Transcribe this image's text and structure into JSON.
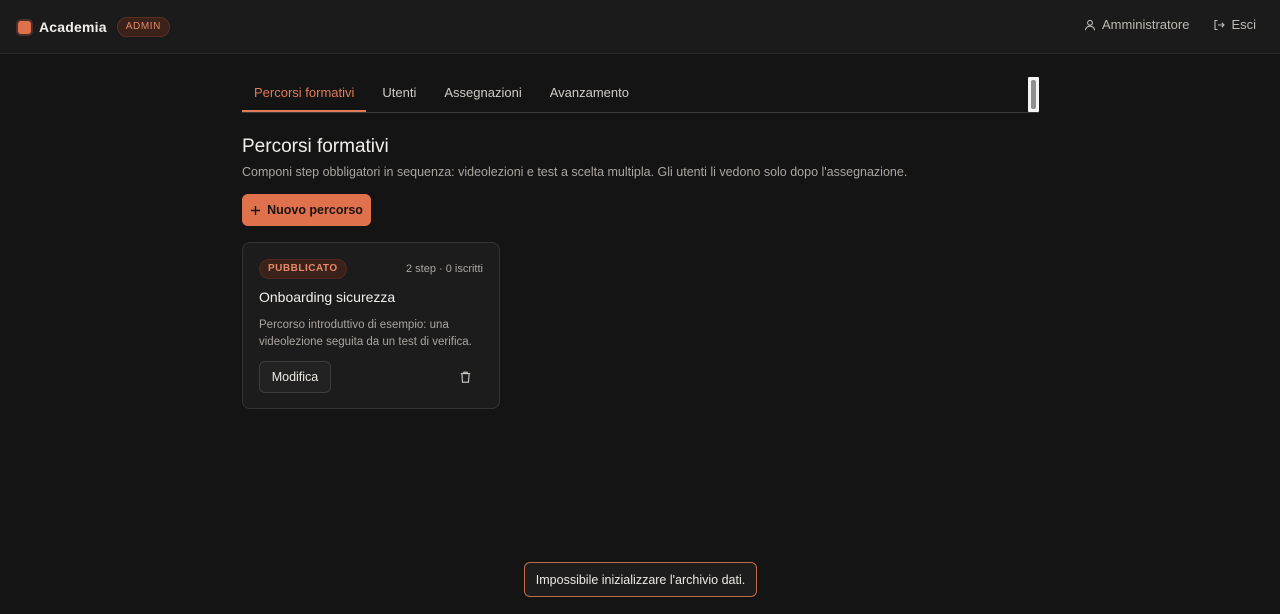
{
  "app": {
    "name": "Academia",
    "role_badge": "ADMIN"
  },
  "header": {
    "user_label": "Amministratore",
    "logout_label": "Esci"
  },
  "tabs": [
    {
      "label": "Percorsi formativi",
      "active": true
    },
    {
      "label": "Utenti",
      "active": false
    },
    {
      "label": "Assegnazioni",
      "active": false
    },
    {
      "label": "Avanzamento",
      "active": false
    }
  ],
  "page": {
    "title": "Percorsi formativi",
    "subtitle": "Componi step obbligatori in sequenza: videolezioni e test a scelta multipla. Gli utenti li vedono solo dopo l'assegnazione.",
    "new_button_label": "Nuovo percorso"
  },
  "courses": [
    {
      "status": "PUBBLICATO",
      "meta": "2 step · 0 iscritti",
      "title": "Onboarding sicurezza",
      "description": "Percorso introduttivo di esempio: una videolezione seguita da un test di verifica.",
      "edit_label": "Modifica"
    }
  ],
  "toast": {
    "message": "Impossibile inizializzare l'archivio dati."
  },
  "colors": {
    "accent": "#e0714d",
    "background": "#141414",
    "card": "#1c1c1c"
  },
  "icons": {
    "brand": "brand-square-icon",
    "user": "user-icon",
    "logout": "logout-icon",
    "plus": "plus-icon",
    "trash": "trash-icon"
  }
}
